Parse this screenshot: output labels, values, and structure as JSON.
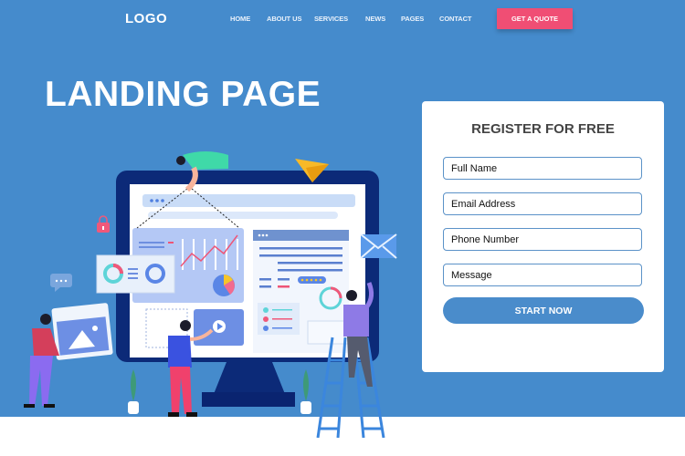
{
  "header": {
    "logo": "LOGO",
    "nav": [
      {
        "label": "HOME"
      },
      {
        "label": "ABOUT US"
      },
      {
        "label": "SERVICES"
      },
      {
        "label": "NEWS"
      },
      {
        "label": "PAGES"
      },
      {
        "label": "CONTACT"
      }
    ],
    "cta_label": "GET A QUOTE"
  },
  "hero": {
    "title": "LANDING PAGE"
  },
  "form": {
    "title": "REGISTER FOR FREE",
    "fields": [
      {
        "placeholder": "Full Name",
        "value": ""
      },
      {
        "placeholder": "Email Address",
        "value": ""
      },
      {
        "placeholder": "Phone Number",
        "value": ""
      },
      {
        "placeholder": "Message",
        "value": ""
      }
    ],
    "submit_label": "START NOW"
  },
  "illustration": {
    "description": "people-building-website-on-monitor",
    "icons": [
      "padlock-icon",
      "paper-plane-icon",
      "envelope-icon",
      "chat-bubble-icon",
      "image-icon",
      "play-icon",
      "pie-chart-icon",
      "line-chart-icon",
      "donut-chart-icon",
      "star-rating-icon"
    ]
  },
  "colors": {
    "hero_bg": "#458bcc",
    "cta": "#f04e74",
    "primary_button": "#4a8ccb",
    "monitor": "#0c2a78"
  }
}
